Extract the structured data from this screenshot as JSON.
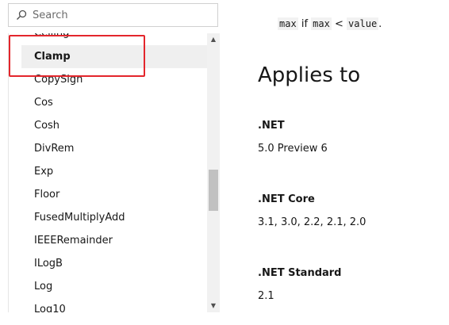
{
  "search": {
    "placeholder": "Search"
  },
  "toc": {
    "items": [
      {
        "label": "Ceiling",
        "selected": false
      },
      {
        "label": "Clamp",
        "selected": true
      },
      {
        "label": "CopySign",
        "selected": false
      },
      {
        "label": "Cos",
        "selected": false
      },
      {
        "label": "Cosh",
        "selected": false
      },
      {
        "label": "DivRem",
        "selected": false
      },
      {
        "label": "Exp",
        "selected": false
      },
      {
        "label": "Floor",
        "selected": false
      },
      {
        "label": "FusedMultiplyAdd",
        "selected": false
      },
      {
        "label": "IEEERemainder",
        "selected": false
      },
      {
        "label": "ILogB",
        "selected": false
      },
      {
        "label": "Log",
        "selected": false
      },
      {
        "label": "Log10",
        "selected": false
      }
    ]
  },
  "content": {
    "code_max": "max",
    "if_text": "if",
    "code_max2": "max",
    "lt": "<",
    "code_value": "value",
    "period": ".",
    "applies_heading": "Applies to",
    "products": [
      {
        "name": ".NET",
        "versions": "5.0 Preview 6"
      },
      {
        "name": ".NET Core",
        "versions": "3.1, 3.0, 2.2, 2.1, 2.0"
      },
      {
        "name": ".NET Standard",
        "versions": "2.1"
      }
    ]
  }
}
